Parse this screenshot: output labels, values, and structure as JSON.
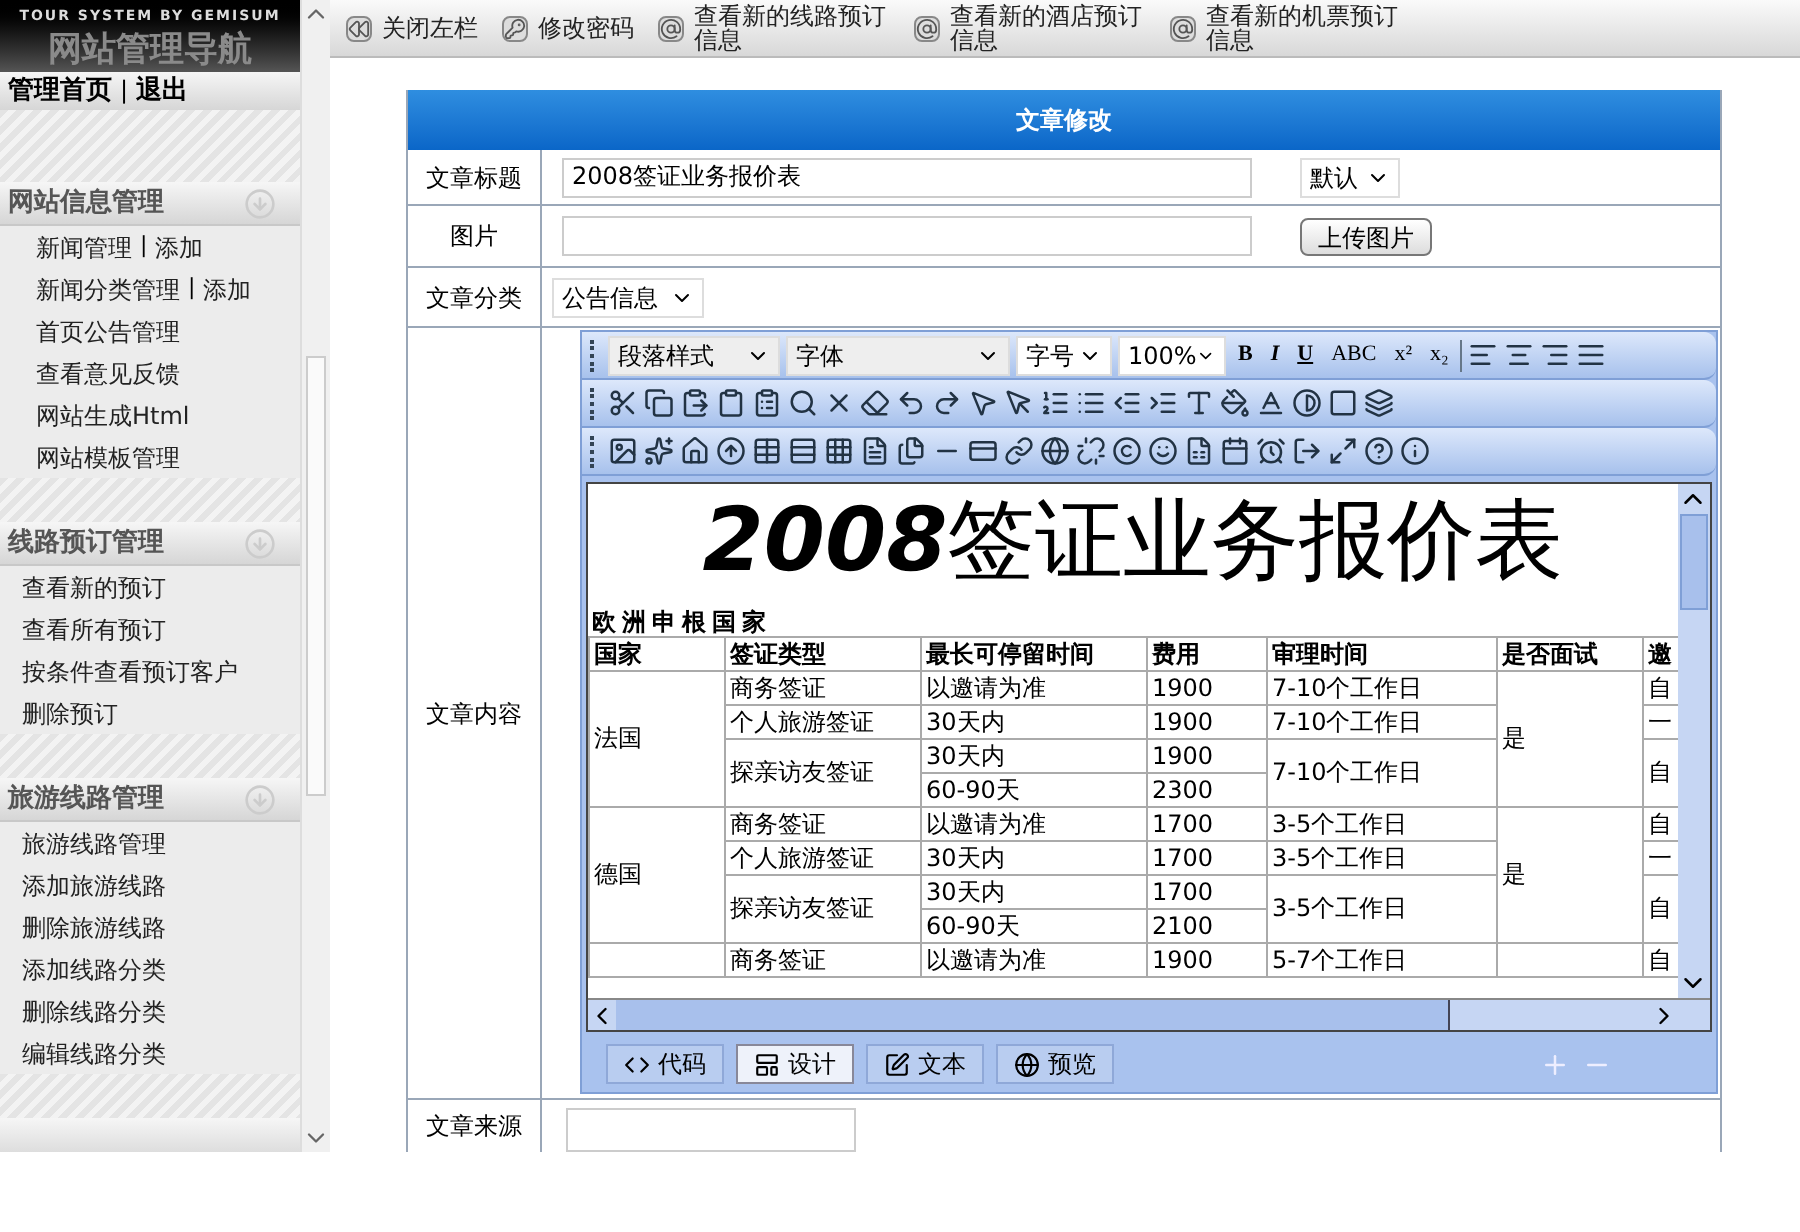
{
  "sidebar": {
    "brand": "TOUR SYSTEM BY GEMISUM",
    "title": "网站管理导航",
    "top_links": [
      "管理首页",
      "退出"
    ],
    "separator": "|",
    "sections": [
      {
        "title": "网站信息管理",
        "items": [
          {
            "label": "新闻管理",
            "extra": "添加"
          },
          {
            "label": "新闻分类管理",
            "extra": "添加"
          },
          {
            "label": "首页公告管理"
          },
          {
            "label": "查看意见反馈"
          },
          {
            "label": "网站生成Html"
          },
          {
            "label": "网站模板管理"
          }
        ]
      },
      {
        "title": "线路预订管理",
        "items": [
          {
            "label": "查看新的预订"
          },
          {
            "label": "查看所有预订"
          },
          {
            "label": "按条件查看预订客户"
          },
          {
            "label": "删除预订"
          }
        ]
      },
      {
        "title": "旅游线路管理",
        "items": [
          {
            "label": "旅游线路管理"
          },
          {
            "label": "添加旅游线路"
          },
          {
            "label": "删除旅游线路"
          },
          {
            "label": "添加线路分类"
          },
          {
            "label": "删除线路分类"
          },
          {
            "label": "编辑线路分类"
          }
        ]
      }
    ]
  },
  "toolbar": [
    "关闭左栏",
    "修改密码",
    "查看新的线路预订信息",
    "查看新的酒店预订信息",
    "查看新的机票预订信息"
  ],
  "form": {
    "heading": "文章修改",
    "title_label": "文章标题",
    "title_value": "2008签证业务报价表",
    "style_select": "默认",
    "image_label": "图片",
    "upload_button": "上传图片",
    "category_label": "文章分类",
    "category_select": "公告信息",
    "content_label": "文章内容",
    "source_label": "文章来源"
  },
  "editor": {
    "paragraph_select": "段落样式",
    "font_select": "字体",
    "size_select": "字号",
    "zoom_select": "100%",
    "format_buttons": [
      "B",
      "I",
      "U",
      "ABC",
      "x²",
      "x₂"
    ],
    "doc_title": "**2008**签证业务报价表",
    "doc_subtitle": "欧洲申根国家",
    "columns": [
      "国家",
      "签证类型",
      "最长可停留时间",
      "费用",
      "审理时间",
      "是否面试",
      "邀"
    ],
    "countries": [
      {
        "name": "法国",
        "interview": "是",
        "visas": [
          {
            "type": "商务签证",
            "stays": [
              {
                "time": "以邀请为准",
                "fee": "1900"
              }
            ],
            "process": "7-10个工作日",
            "invite": "自"
          },
          {
            "type": "个人旅游签证",
            "stays": [
              {
                "time": "30天内",
                "fee": "1900"
              }
            ],
            "process": "7-10个工作日",
            "invite": "一"
          },
          {
            "type": "探亲访友签证",
            "stays": [
              {
                "time": "30天内",
                "fee": "1900"
              },
              {
                "time": "60-90天",
                "fee": "2300"
              }
            ],
            "process": "7-10个工作日",
            "invite": "自"
          }
        ]
      },
      {
        "name": "德国",
        "interview": "是",
        "visas": [
          {
            "type": "商务签证",
            "stays": [
              {
                "time": "以邀请为准",
                "fee": "1700"
              }
            ],
            "process": "3-5个工作日",
            "invite": "自"
          },
          {
            "type": "个人旅游签证",
            "stays": [
              {
                "time": "30天内",
                "fee": "1700"
              }
            ],
            "process": "3-5个工作日",
            "invite": "一"
          },
          {
            "type": "探亲访友签证",
            "stays": [
              {
                "time": "30天内",
                "fee": "1700"
              },
              {
                "time": "60-90天",
                "fee": "2100"
              }
            ],
            "process": "3-5个工作日",
            "invite": "自"
          }
        ]
      },
      {
        "visas": [
          {
            "type": "商务签证",
            "stays": [
              {
                "time": "以邀请为准",
                "fee": "1900"
              }
            ],
            "process": "5-7个工作日",
            "invite": "自"
          }
        ]
      }
    ],
    "modes": [
      {
        "label": "代码",
        "selected": false
      },
      {
        "label": "设计",
        "selected": true
      },
      {
        "label": "文本",
        "selected": false
      },
      {
        "label": "预览",
        "selected": false
      }
    ]
  }
}
